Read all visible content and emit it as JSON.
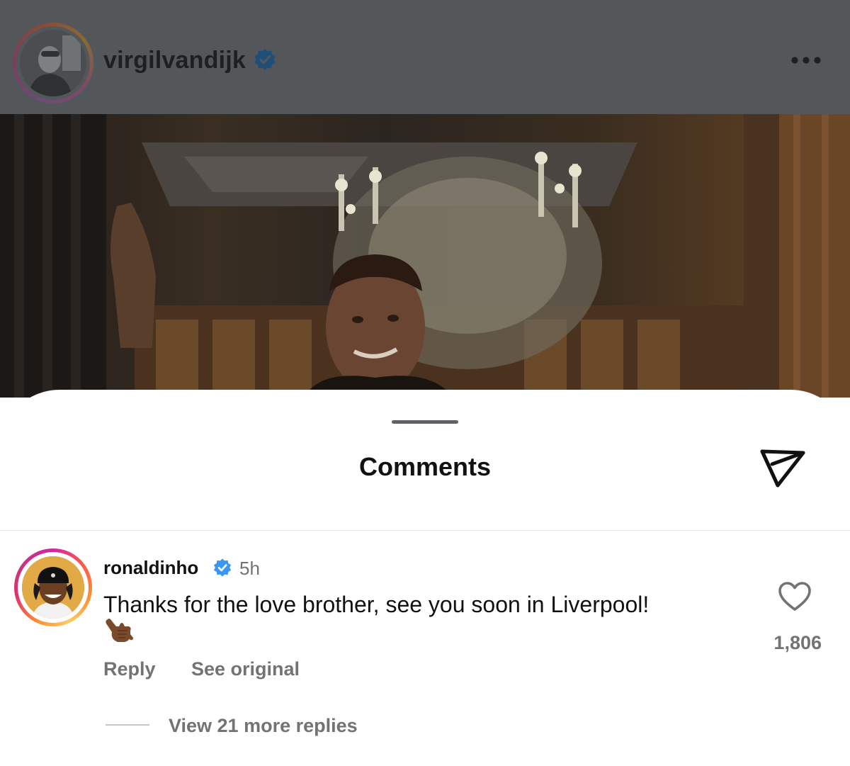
{
  "post": {
    "username": "virgilvandijk",
    "verified": true
  },
  "sheet": {
    "title": "Comments"
  },
  "comment": {
    "username": "ronaldinho",
    "verified": true,
    "time": "5h",
    "text": "Thanks for the love brother, see you soon in Liverpool!",
    "emoji": "shaka-emoji",
    "reply_label": "Reply",
    "see_original_label": "See original",
    "like_count": "1,806"
  },
  "replies": {
    "view_more_label": "View 21 more replies"
  },
  "colors": {
    "verified": "#3897f0",
    "secondary_text": "#737373",
    "primary_text": "#111111",
    "overlay": "#54575a"
  }
}
